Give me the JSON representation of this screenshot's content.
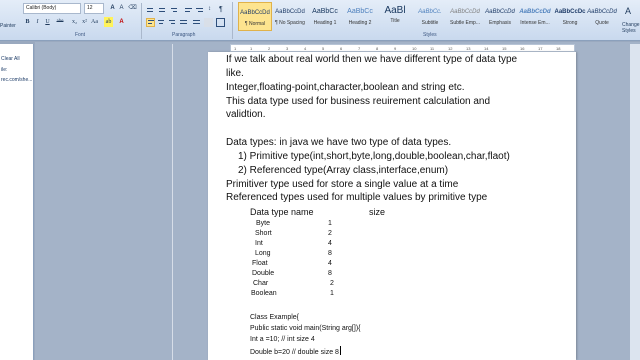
{
  "ribbon": {
    "clipboard": {
      "painter_label": "Painter"
    },
    "font": {
      "font_name": "Calibri (Body)",
      "font_size": "12",
      "group_label": "Font",
      "bold": "B",
      "italic": "I",
      "underline": "U",
      "strike": "abe"
    },
    "paragraph": {
      "group_label": "Paragraph"
    },
    "styles": {
      "group_label": "Styles",
      "items": [
        {
          "sample": "AaBbCcDd",
          "name": "¶ Normal"
        },
        {
          "sample": "AaBbCcDd",
          "name": "¶ No Spacing"
        },
        {
          "sample": "AaBbCc",
          "name": "Heading 1"
        },
        {
          "sample": "AaBbCc",
          "name": "Heading 2"
        },
        {
          "sample": "AaBl",
          "name": "Title"
        },
        {
          "sample": "AaBbCc.",
          "name": "Subtitle"
        },
        {
          "sample": "AaBbCcDd",
          "name": "Subtle Emp..."
        },
        {
          "sample": "AaBbCcDd",
          "name": "Emphasis"
        },
        {
          "sample": "AaBbCcDd",
          "name": "Intense Em..."
        },
        {
          "sample": "AaBbCcDc",
          "name": "Strong"
        },
        {
          "sample": "AaBbCcDd",
          "name": "Quote"
        }
      ],
      "change_styles": "Change Styles"
    }
  },
  "left_pane": {
    "items": [
      "Clear All",
      "ile:",
      "rec.com/she..."
    ]
  },
  "ruler": {
    "ticks": [
      "1",
      "1",
      "2",
      "3",
      "4",
      "5",
      "6",
      "7",
      "8",
      "9",
      "10",
      "11",
      "12",
      "13",
      "14",
      "15",
      "16",
      "17",
      "18"
    ]
  },
  "document": {
    "lines": [
      "If we talk about real world  then we have different type of data type",
      "like.",
      "Integer,floating-point,character,boolean  and string etc.",
      "This data type  used  for business reuirement  calculation  and",
      "validtion.",
      "Data types: in java  we have two type of data types.",
      "1)  Primitive type(int,short,byte,long,double,boolean,char,flaot)",
      "2)  Referenced  type(Array class,interface,enum)",
      "Primitiver type used for store a single value at a time",
      "Referenced  types  used for multiple values   by primitive type"
    ],
    "table_header": {
      "name": "Data type name",
      "size": "size"
    },
    "table_rows": [
      {
        "name": "Byte",
        "size": "1"
      },
      {
        "name": "Short",
        "size": "2"
      },
      {
        "name": "Int",
        "size": "4"
      },
      {
        "name": "Long",
        "size": "8"
      },
      {
        "name": "Float",
        "size": "4"
      },
      {
        "name": "Double",
        "size": "8"
      },
      {
        "name": "Char",
        "size": "2"
      },
      {
        "name": "Boolean",
        "size": "1"
      }
    ],
    "code_lines": [
      "Class Example{",
      "Public static void main(String arg[]){",
      "Int a =10; // int size 4",
      "Double b=20 // double size 8"
    ]
  }
}
